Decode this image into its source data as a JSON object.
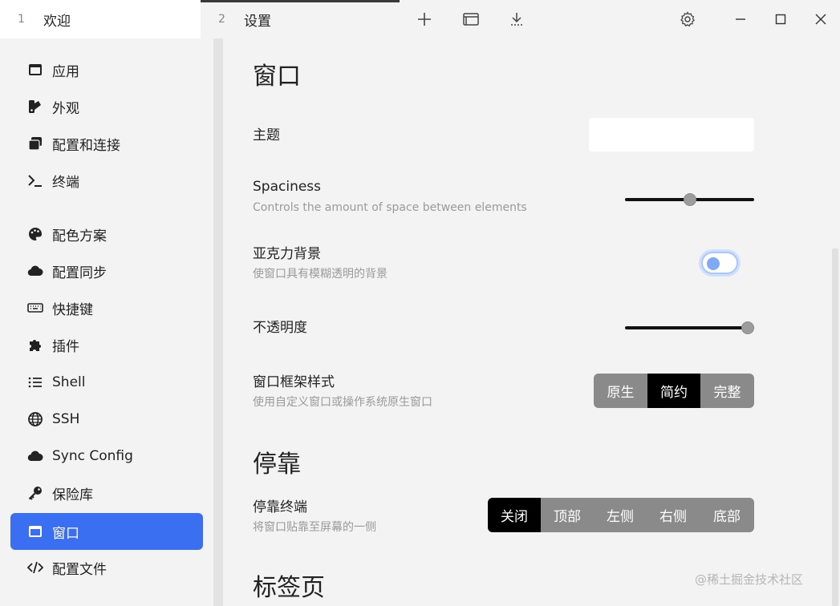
{
  "tabs": [
    {
      "num": "1",
      "label": "欢迎"
    },
    {
      "num": "2",
      "label": "设置"
    }
  ],
  "toolbar": {
    "new_tab_icon": "plus-icon",
    "window_icon": "window-icon",
    "download_icon": "download-icon",
    "settings_icon": "gear-icon",
    "minimize_icon": "minimize-icon",
    "maximize_icon": "maximize-icon",
    "close_icon": "close-icon"
  },
  "sidebar": {
    "items": [
      {
        "label": "应用",
        "icon": "app-window-icon"
      },
      {
        "label": "外观",
        "icon": "swatch-icon"
      },
      {
        "label": "配置和连接",
        "icon": "profiles-icon"
      },
      {
        "label": "终端",
        "icon": "terminal-icon"
      },
      {
        "label": "配色方案",
        "icon": "palette-icon"
      },
      {
        "label": "配置同步",
        "icon": "cloud-icon"
      },
      {
        "label": "快捷键",
        "icon": "keyboard-icon"
      },
      {
        "label": "插件",
        "icon": "puzzle-icon"
      },
      {
        "label": "Shell",
        "icon": "list-icon"
      },
      {
        "label": "SSH",
        "icon": "globe-icon"
      },
      {
        "label": "Sync Config",
        "icon": "cloud-icon"
      },
      {
        "label": "保险库",
        "icon": "key-icon"
      },
      {
        "label": "窗口",
        "icon": "window-icon"
      },
      {
        "label": "配置文件",
        "icon": "code-icon"
      }
    ],
    "active_item": "窗口"
  },
  "content": {
    "section_window": "窗口",
    "theme": {
      "label": "主题",
      "value": ""
    },
    "spaciness": {
      "label": "Spaciness",
      "desc": "Controls the amount of space between elements",
      "value": 0.5
    },
    "acrylic": {
      "label": "亚克力背景",
      "desc": "使窗口具有模糊透明的背景",
      "enabled": false
    },
    "opacity": {
      "label": "不透明度",
      "value": 1.0
    },
    "frame": {
      "label": "窗口框架样式",
      "desc": "使用自定义窗口或操作系统原生窗口",
      "options": [
        "原生",
        "简约",
        "完整"
      ],
      "selected": "简约"
    },
    "section_dock": "停靠",
    "dock": {
      "label": "停靠终端",
      "desc": "将窗口贴靠至屏幕的一侧",
      "options": [
        "关闭",
        "顶部",
        "左侧",
        "右侧",
        "底部"
      ],
      "selected": "关闭"
    },
    "section_tabs": "标签页"
  },
  "watermark": "@稀土掘金技术社区",
  "colors": {
    "accent": "#3a6ff2",
    "background": "#f3f3f3",
    "segment_selected": "#000000",
    "segment_default": "#8a8a8a"
  }
}
